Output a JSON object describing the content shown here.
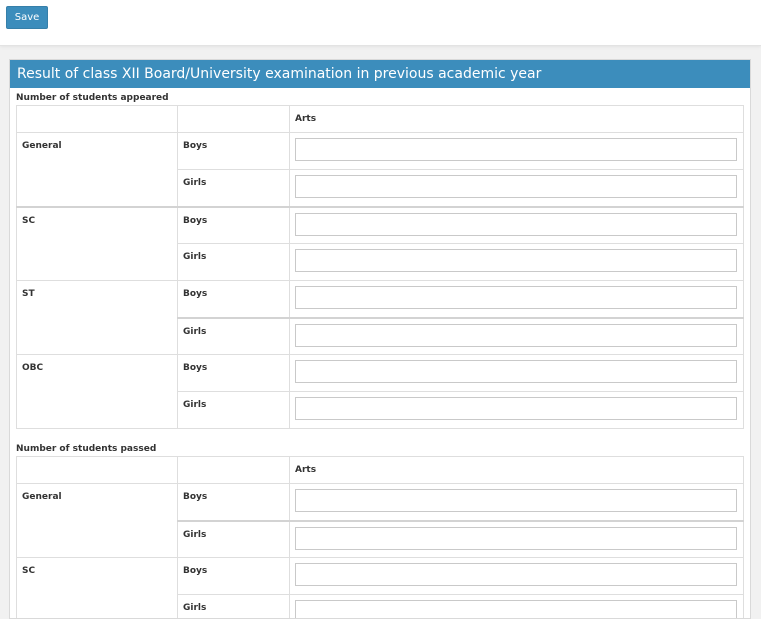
{
  "toolbar": {
    "save_label": "Save"
  },
  "panel": {
    "title": "Result of class XII Board/University examination in previous academic year"
  },
  "sections": [
    {
      "title": "Number of students appeared",
      "column_header": "Arts",
      "groups": [
        {
          "category": "General",
          "rows": [
            {
              "gender": "Boys",
              "value": ""
            },
            {
              "gender": "Girls",
              "value": ""
            }
          ]
        },
        {
          "category": "SC",
          "rows": [
            {
              "gender": "Boys",
              "value": ""
            },
            {
              "gender": "Girls",
              "value": ""
            }
          ]
        },
        {
          "category": "ST",
          "rows": [
            {
              "gender": "Boys",
              "value": ""
            },
            {
              "gender": "Girls",
              "value": ""
            }
          ]
        },
        {
          "category": "OBC",
          "rows": [
            {
              "gender": "Boys",
              "value": ""
            },
            {
              "gender": "Girls",
              "value": ""
            }
          ]
        }
      ]
    },
    {
      "title": "Number of students passed",
      "column_header": "Arts",
      "groups": [
        {
          "category": "General",
          "rows": [
            {
              "gender": "Boys",
              "value": ""
            },
            {
              "gender": "Girls",
              "value": ""
            }
          ]
        },
        {
          "category": "SC",
          "rows": [
            {
              "gender": "Boys",
              "value": ""
            },
            {
              "gender": "Girls",
              "value": ""
            }
          ]
        }
      ]
    }
  ]
}
